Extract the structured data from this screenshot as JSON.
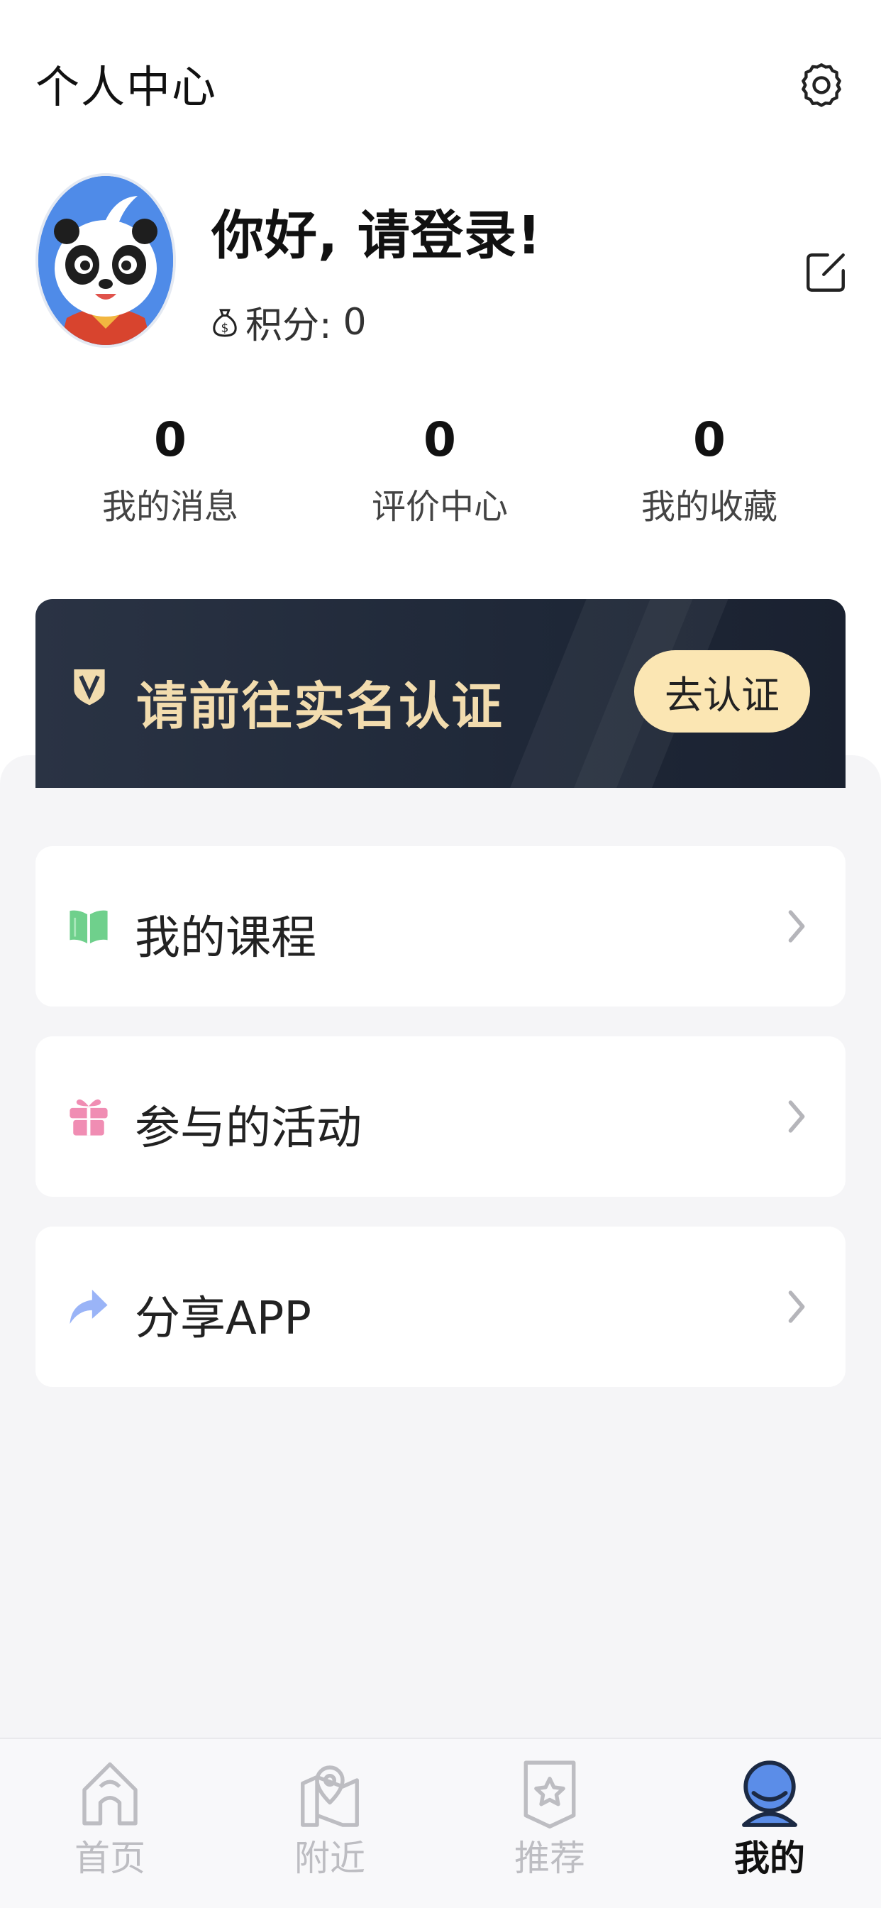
{
  "header": {
    "title": "个人中心",
    "settings_icon": "gear-icon"
  },
  "profile": {
    "greeting": "你好, 请登录!",
    "points_label": "积分:",
    "points_value": "0",
    "avatar": "panda-avatar",
    "edit_icon": "edit-icon"
  },
  "stats": [
    {
      "value": "0",
      "label": "我的消息"
    },
    {
      "value": "0",
      "label": "评价中心"
    },
    {
      "value": "0",
      "label": "我的收藏"
    }
  ],
  "verify_banner": {
    "text": "请前往实名认证",
    "button_label": "去认证",
    "icon": "v-shield-icon",
    "colors": {
      "background": "#222b3a",
      "text": "#f2dcae",
      "button": "#fbe6b3"
    }
  },
  "menu": [
    {
      "label": "我的课程",
      "icon": "book-icon",
      "color": "#6fd08c"
    },
    {
      "label": "参与的活动",
      "icon": "gift-icon",
      "color": "#f08db3"
    },
    {
      "label": "分享APP",
      "icon": "share-icon",
      "color": "#9ab4f7"
    }
  ],
  "tabbar": {
    "active": "我的",
    "items": [
      {
        "label": "首页",
        "icon": "home-icon"
      },
      {
        "label": "附近",
        "icon": "location-map-icon"
      },
      {
        "label": "推荐",
        "icon": "star-badge-icon"
      },
      {
        "label": "我的",
        "icon": "user-icon"
      }
    ]
  }
}
